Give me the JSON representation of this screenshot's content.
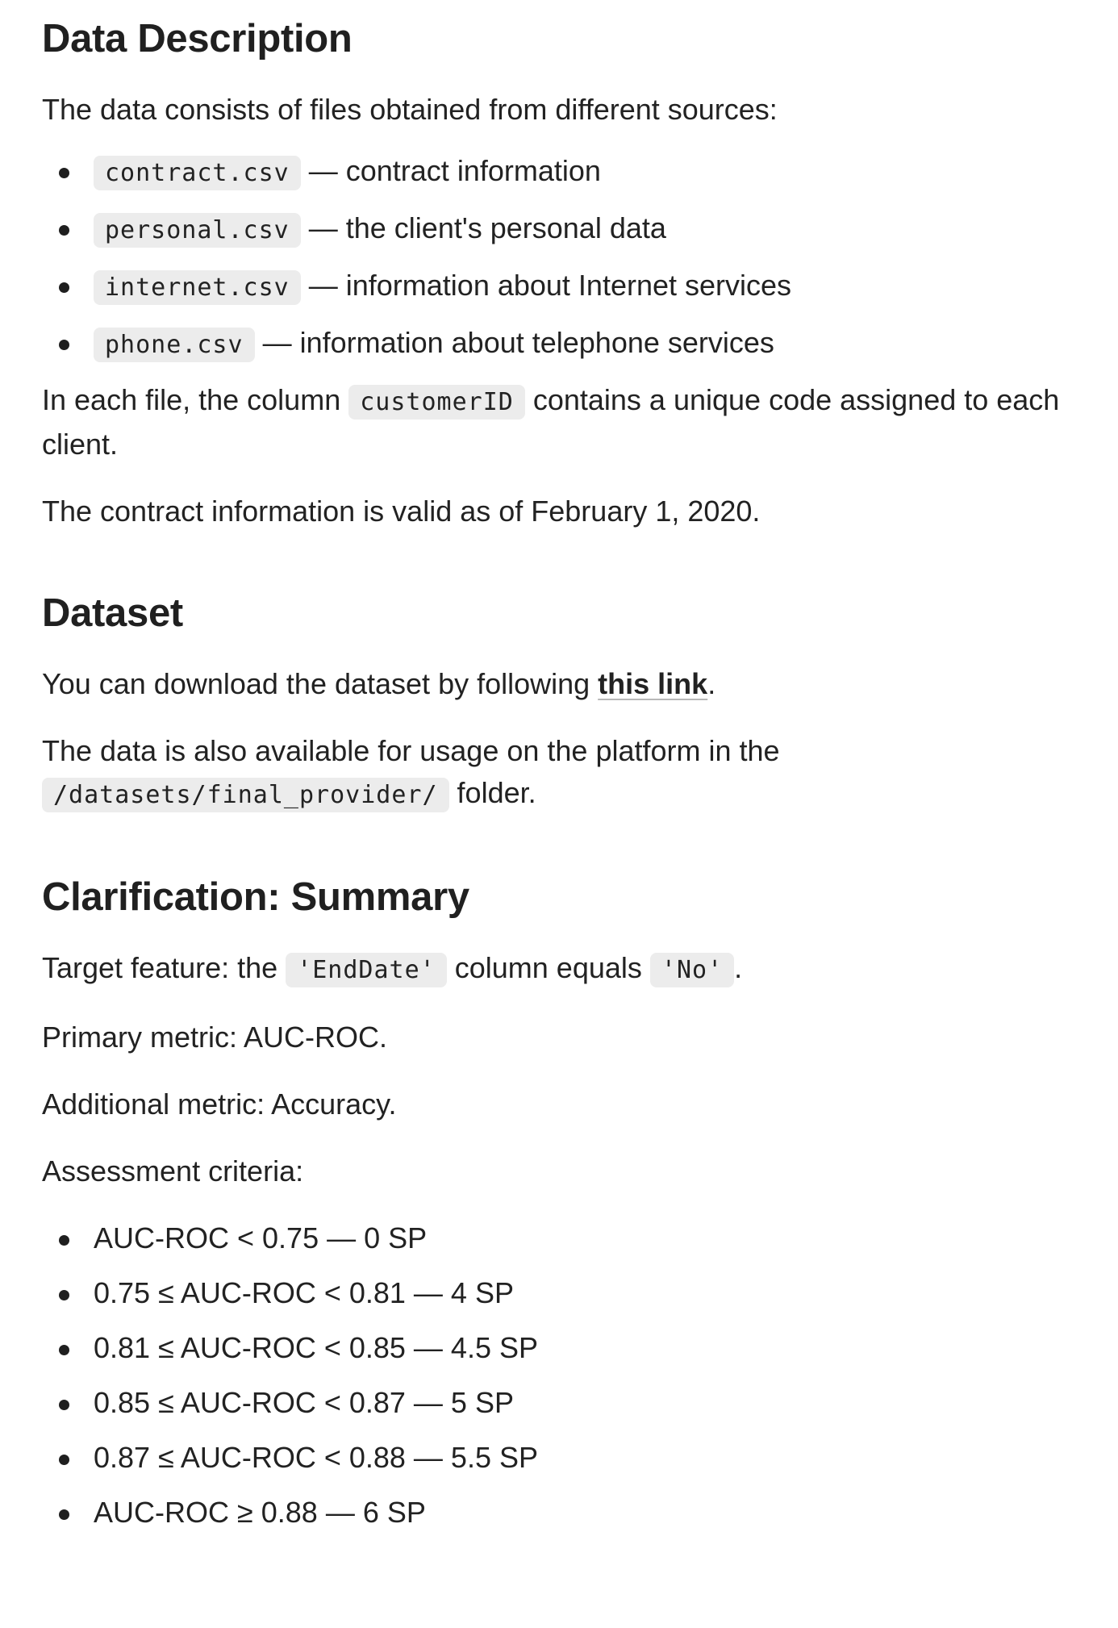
{
  "section_description": {
    "title": "Data Description",
    "intro": "The data consists of files obtained from different sources:",
    "files": [
      {
        "name": "contract.csv",
        "desc": " — contract information"
      },
      {
        "name": "personal.csv",
        "desc": " — the client's personal data"
      },
      {
        "name": "internet.csv",
        "desc": " — information about Internet services"
      },
      {
        "name": "phone.csv",
        "desc": " — information about telephone services"
      }
    ],
    "column_para": {
      "before": "In each file, the column ",
      "code": "customerID",
      "after": " contains a unique code assigned to each client."
    },
    "validity": "The contract information is valid as of February 1, 2020."
  },
  "section_dataset": {
    "title": "Dataset",
    "download": {
      "before": "You can download the dataset by following ",
      "link": "this link",
      "after": "."
    },
    "platform": {
      "before": "The data is also available for usage on the platform in the ",
      "code": "/datasets/final_provider/",
      "after": " folder."
    }
  },
  "section_summary": {
    "title": "Clarification: Summary",
    "target": {
      "before": "Target feature: the ",
      "code1": "'EndDate'",
      "middle": " column equals ",
      "code2": "'No'",
      "after": "."
    },
    "primary_metric": "Primary metric: AUC-ROC.",
    "additional_metric": "Additional metric: Accuracy.",
    "criteria_label": "Assessment criteria:",
    "criteria": [
      "AUC-ROC < 0.75 — 0 SP",
      "0.75 ≤ AUC-ROC < 0.81 — 4 SP",
      "0.81 ≤ AUC-ROC < 0.85 — 4.5 SP",
      "0.85 ≤ AUC-ROC < 0.87 — 5 SP",
      "0.87 ≤ AUC-ROC < 0.88 — 5.5 SP",
      "AUC-ROC ≥ 0.88 — 6 SP"
    ]
  }
}
